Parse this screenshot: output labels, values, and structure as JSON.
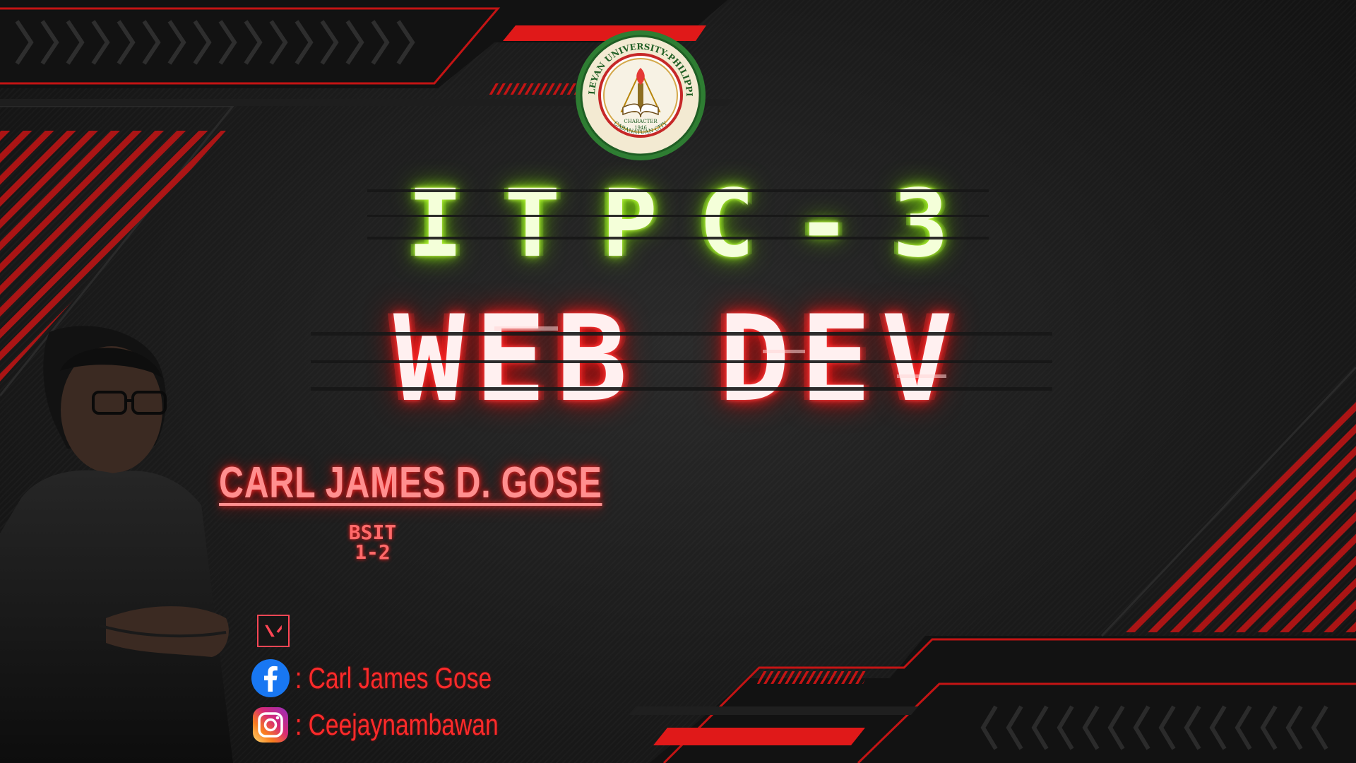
{
  "title": {
    "course_code": "ITPC-3",
    "course_name": "WEB DEV"
  },
  "seal": {
    "name": "WESLEYAN UNIVERSITY-PHILIPPINES",
    "year": "1946",
    "motto_word": "CHARACTER",
    "location": "CABANATUAN CITY"
  },
  "student": {
    "name": "CARL JAMES D. GOSE",
    "section_line1": "BSIT",
    "section_line2": "1-2"
  },
  "socials": {
    "game_icon": "valorant-logo-icon",
    "facebook": {
      "icon": "facebook-icon",
      "text": ": Carl James Gose"
    },
    "instagram": {
      "icon": "instagram-icon",
      "text": ": Ceejaynambawan"
    }
  },
  "colors": {
    "accent_red": "#ff2a2a",
    "neon_green": "#8fe21c",
    "background": "#1b1b1b"
  }
}
